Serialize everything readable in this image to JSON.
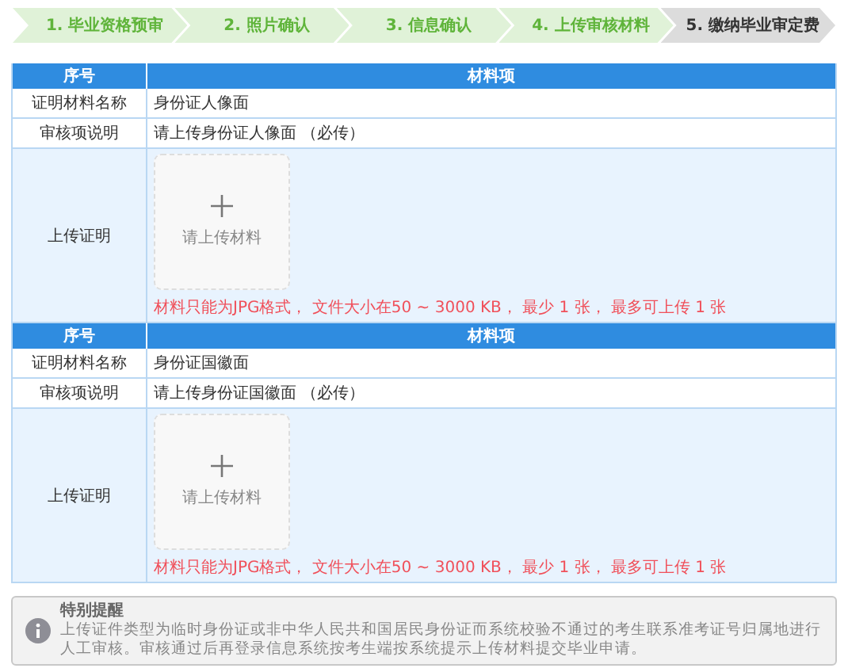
{
  "steps": [
    {
      "label": "1. 毕业资格预审",
      "selected": false
    },
    {
      "label": "2. 照片确认",
      "selected": false
    },
    {
      "label": "3. 信息确认",
      "selected": false
    },
    {
      "label": "4. 上传审核材料",
      "selected": false
    },
    {
      "label": "5. 缴纳毕业审定费",
      "selected": true
    }
  ],
  "sections": [
    {
      "columns": [
        "序号",
        "材料项"
      ],
      "rows": [
        {
          "label": "证明材料名称",
          "value": "身份证人像面"
        },
        {
          "label": "审核项说明",
          "value": "请上传身份证人像面 （必传）"
        }
      ],
      "upload": {
        "label": "上传证明",
        "placeholder": "请上传材料",
        "hint": "材料只能为JPG格式， 文件大小在50 ~ 3000 KB， 最少 1 张， 最多可上传 1 张"
      }
    },
    {
      "columns": [
        "序号",
        "材料项"
      ],
      "rows": [
        {
          "label": "证明材料名称",
          "value": "身份证国徽面"
        },
        {
          "label": "审核项说明",
          "value": "请上传身份证国徽面 （必传）"
        }
      ],
      "upload": {
        "label": "上传证明",
        "placeholder": "请上传材料",
        "hint": "材料只能为JPG格式， 文件大小在50 ~ 3000 KB， 最少 1 张， 最多可上传 1 张"
      }
    }
  ],
  "notice": {
    "title": "特别提醒",
    "text": "上传证件类型为临时身份证或非中华人民共和国居民身份证而系统校验不通过的考生联系准考证号归属地进行人工审核。审核通过后再登录信息系统按考生端按系统提示上传材料提交毕业申请。"
  }
}
